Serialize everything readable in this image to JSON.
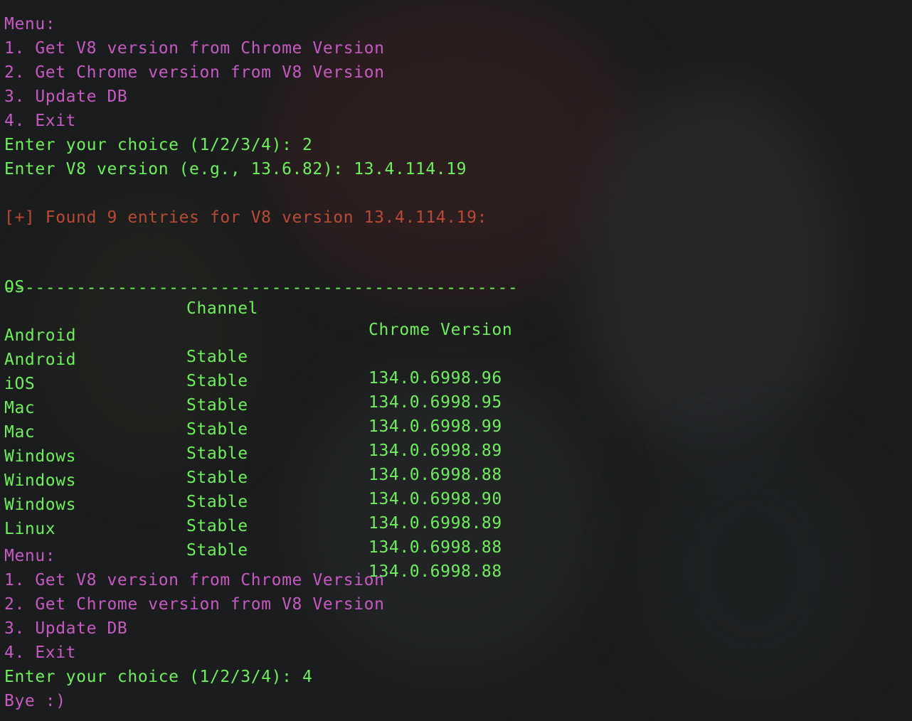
{
  "colors": {
    "background": "#1b1c1d",
    "menu": "#c75ac2",
    "prompt": "#6ef05a",
    "found": "#b94a33"
  },
  "session1": {
    "menu_title": "Menu:",
    "menu_items": [
      "1. Get V8 version from Chrome Version",
      "2. Get Chrome version from V8 Version",
      "3. Update DB",
      "4. Exit"
    ],
    "choice_prompt": "Enter your choice (1/2/3/4): 2",
    "version_prompt": "Enter V8 version (e.g., 13.6.82): 13.4.114.19"
  },
  "result": {
    "found_line": "[+] Found 9 entries for V8 version 13.4.114.19:",
    "headers": [
      "OS",
      "Channel",
      "Chrome Version"
    ],
    "separator": "--------------------------------------------------",
    "rows": [
      [
        "Android",
        "Stable",
        "134.0.6998.96"
      ],
      [
        "Android",
        "Stable",
        "134.0.6998.95"
      ],
      [
        "iOS",
        "Stable",
        "134.0.6998.99"
      ],
      [
        "Mac",
        "Stable",
        "134.0.6998.89"
      ],
      [
        "Mac",
        "Stable",
        "134.0.6998.88"
      ],
      [
        "Windows",
        "Stable",
        "134.0.6998.90"
      ],
      [
        "Windows",
        "Stable",
        "134.0.6998.89"
      ],
      [
        "Windows",
        "Stable",
        "134.0.6998.88"
      ],
      [
        "Linux",
        "Stable",
        "134.0.6998.88"
      ]
    ]
  },
  "session2": {
    "menu_title": "Menu:",
    "menu_items": [
      "1. Get V8 version from Chrome Version",
      "2. Get Chrome version from V8 Version",
      "3. Update DB",
      "4. Exit"
    ],
    "choice_prompt": "Enter your choice (1/2/3/4): 4",
    "bye": "Bye :)"
  }
}
